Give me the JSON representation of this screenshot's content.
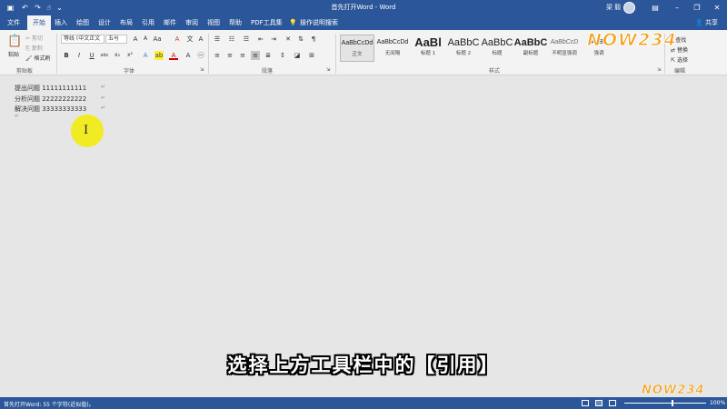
{
  "window": {
    "title": "首先打开Word - Word",
    "user": "梁 毅",
    "qa": {
      "save_icon": "save-icon",
      "undo_icon": "undo-icon",
      "redo_icon": "redo-icon",
      "more_icon": "customize-icon"
    }
  },
  "tabs": [
    "文件",
    "开始",
    "插入",
    "绘图",
    "设计",
    "布局",
    "引用",
    "邮件",
    "审阅",
    "视图",
    "帮助",
    "PDF工具集"
  ],
  "tell_me": "操作说明搜索",
  "share": "共享",
  "ribbon": {
    "clipboard": {
      "paste": "粘贴",
      "cut": "剪切",
      "copy": "复制",
      "format_painter": "格式刷",
      "label": "剪贴板"
    },
    "font": {
      "name": "等线 (中文正文",
      "size": "五号",
      "label": "字体"
    },
    "paragraph": {
      "label": "段落"
    },
    "styles": {
      "label": "样式",
      "items": [
        {
          "sample": "AaBbCcDd",
          "name": "正文"
        },
        {
          "sample": "AaBbCcDd",
          "name": "无间隔"
        },
        {
          "sample": "AaBl",
          "name": "标题 1"
        },
        {
          "sample": "AaBbC",
          "name": "标题 2"
        },
        {
          "sample": "AaBbC",
          "name": "标题"
        },
        {
          "sample": "AaBbC",
          "name": "副标题"
        },
        {
          "sample": "AaBbCcD",
          "name": "不明显强调"
        },
        {
          "sample": "AaBb",
          "name": "强调"
        }
      ]
    },
    "editing": {
      "find": "查找",
      "replace": "替换",
      "select": "选择",
      "label": "编辑"
    }
  },
  "document": {
    "lines": [
      "提出问题 11111111111",
      "分析问题 22222222222",
      "解决问题 33333333333"
    ],
    "para_mark": "↵"
  },
  "caption": "选择上方工具栏中的【引用】",
  "status": {
    "text": "首先打开Word: 55 个字符(近似值)。",
    "zoom": "100%"
  },
  "watermark": "NOW234",
  "colors": {
    "brand": "#2b579a",
    "cursor_highlight": "#f2ec13"
  }
}
